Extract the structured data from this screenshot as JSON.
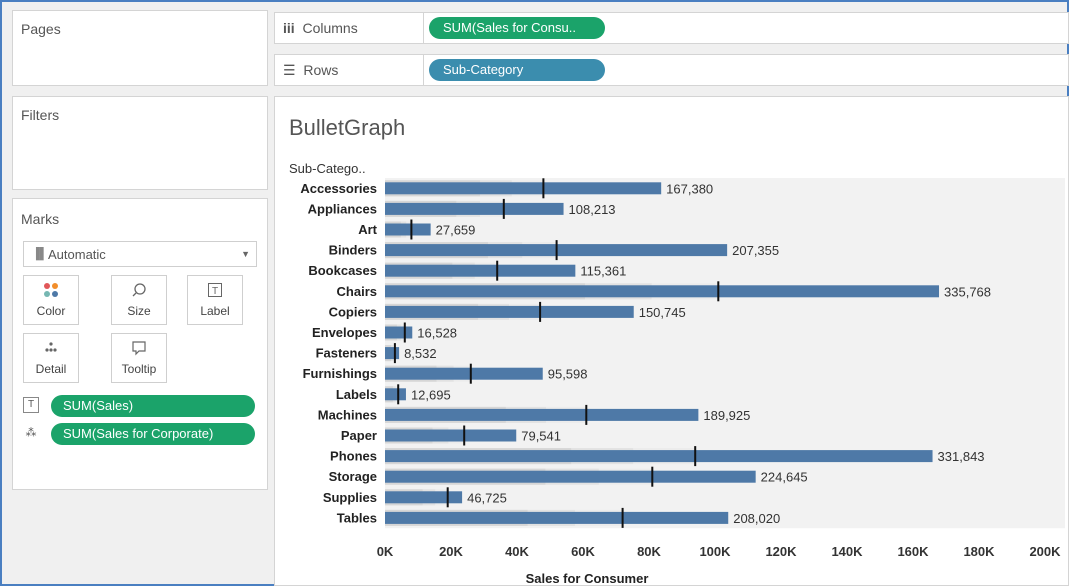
{
  "left_panel": {
    "pages_title": "Pages",
    "filters_title": "Filters",
    "marks_title": "Marks",
    "mark_type": "Automatic",
    "mark_buttons": [
      {
        "icon": "color-icon",
        "glyph": "⠶",
        "label": "Color"
      },
      {
        "icon": "size-icon",
        "glyph": "⚲",
        "label": "Size"
      },
      {
        "icon": "label-icon",
        "glyph": "T",
        "label": "Label"
      },
      {
        "icon": "detail-icon",
        "glyph": "⁂",
        "label": "Detail"
      },
      {
        "icon": "tooltip-icon",
        "glyph": "▭",
        "label": "Tooltip"
      }
    ],
    "mark_pills": [
      {
        "icon": "label-icon",
        "text": "SUM(Sales)"
      },
      {
        "icon": "detail-icon",
        "text": "SUM(Sales for Corporate)"
      }
    ]
  },
  "shelves": {
    "columns_label": "Columns",
    "columns_pill": "SUM(Sales for Consu..",
    "rows_label": "Rows",
    "rows_pill": "Sub-Category"
  },
  "colors": {
    "measure_pill": "#1ba36a",
    "dimension_pill": "#3b8dae",
    "bar": "#4e79a7",
    "band_dark": "#d6d6d6",
    "band_mid": "#e2e2e2",
    "band_light": "#ececec",
    "row_bg": "#f2f2f2",
    "reference_line": "#111111"
  },
  "chart_data": {
    "type": "bar",
    "title": "BulletGraph",
    "row_header": "Sub-Catego..",
    "xlabel": "Sales for Consumer",
    "xlim": [
      0,
      200000
    ],
    "xticks": [
      "0K",
      "20K",
      "40K",
      "60K",
      "80K",
      "100K",
      "120K",
      "140K",
      "160K",
      "180K",
      "200K"
    ],
    "categories": [
      "Accessories",
      "Appliances",
      "Art",
      "Binders",
      "Bookcases",
      "Chairs",
      "Copiers",
      "Envelopes",
      "Fasteners",
      "Furnishings",
      "Labels",
      "Machines",
      "Paper",
      "Phones",
      "Storage",
      "Supplies",
      "Tables"
    ],
    "series": [
      {
        "name": "SUM(Sales)",
        "values": [
          167380,
          108213,
          27659,
          207355,
          115361,
          335768,
          150745,
          16528,
          8532,
          95598,
          12695,
          189925,
          79541,
          331843,
          224645,
          46725,
          208020
        ]
      },
      {
        "name": "SUM(Sales for Corporate)",
        "values": [
          48000,
          36000,
          8000,
          52000,
          34000,
          101000,
          47000,
          6000,
          3000,
          26000,
          4000,
          61000,
          24000,
          94000,
          81000,
          19000,
          72000
        ]
      }
    ],
    "data_labels": [
      "167,380",
      "108,213",
      "27,659",
      "207,355",
      "115,361",
      "335,768",
      "150,745",
      "16,528",
      "8,532",
      "95,598",
      "12,695",
      "189,925",
      "79,541",
      "331,843",
      "224,645",
      "46,725",
      "208,020"
    ]
  }
}
